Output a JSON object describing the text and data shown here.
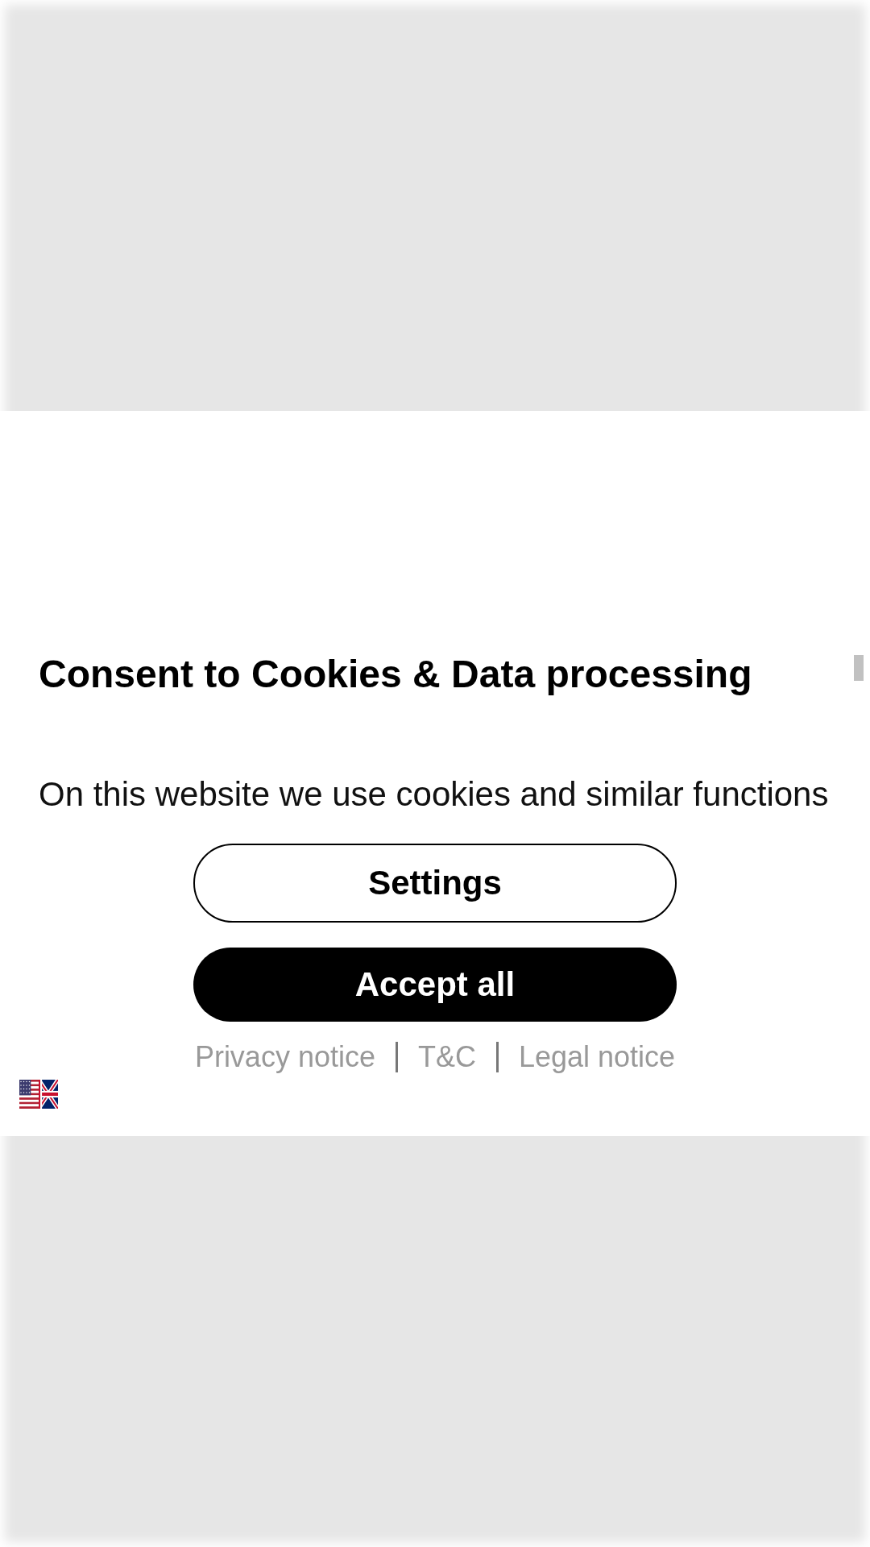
{
  "dialog": {
    "title": "Consent to Cookies & Data processing",
    "body": "On this website we use cookies and similar functions"
  },
  "buttons": [
    {
      "label": "Settings",
      "kind": "outline"
    },
    {
      "label": "Accept all",
      "kind": "filled"
    }
  ],
  "links": [
    "Privacy notice",
    "T&C",
    "Legal notice"
  ]
}
